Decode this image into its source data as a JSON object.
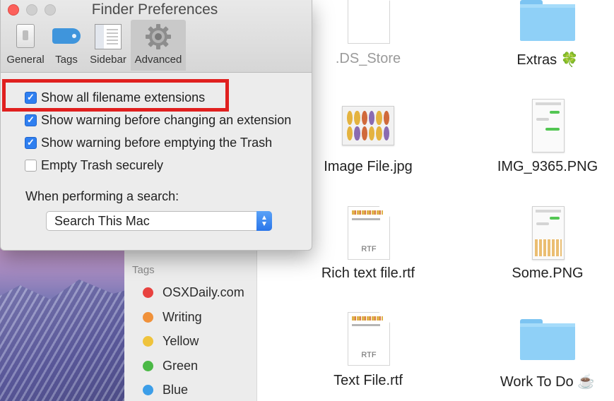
{
  "window": {
    "title": "Finder Preferences",
    "toolbar": [
      {
        "label": "General",
        "icon": "general-icon"
      },
      {
        "label": "Tags",
        "icon": "tag-icon"
      },
      {
        "label": "Sidebar",
        "icon": "sidebar-icon"
      },
      {
        "label": "Advanced",
        "icon": "gear-icon",
        "active": true
      }
    ]
  },
  "advanced": {
    "options": [
      {
        "label": "Show all filename extensions",
        "checked": true
      },
      {
        "label": "Show warning before changing an extension",
        "checked": true
      },
      {
        "label": "Show warning before emptying the Trash",
        "checked": true
      },
      {
        "label": "Empty Trash securely",
        "checked": false
      }
    ],
    "search_label": "When performing a search:",
    "search_value": "Search This Mac"
  },
  "sidebar": {
    "heading": "Tags",
    "tags": [
      {
        "label": "OSXDaily.com",
        "color": "#e8423f"
      },
      {
        "label": "Writing",
        "color": "#f0913a"
      },
      {
        "label": "Yellow",
        "color": "#efc33c"
      },
      {
        "label": "Green",
        "color": "#4bb946"
      },
      {
        "label": "Blue",
        "color": "#3c9ee8"
      }
    ]
  },
  "files": [
    {
      "name": ".DS_Store",
      "kind": "document",
      "dimmed": true
    },
    {
      "name": "Extras 🍀",
      "kind": "folder"
    },
    {
      "name": "Image File.jpg",
      "kind": "image"
    },
    {
      "name": "IMG_9365.PNG",
      "kind": "screenshot"
    },
    {
      "name": "Rich text file.rtf",
      "kind": "rtf",
      "badge": "RTF"
    },
    {
      "name": "Some.PNG",
      "kind": "screenshot"
    },
    {
      "name": "Text File.rtf",
      "kind": "rtf",
      "badge": "RTF"
    },
    {
      "name": "Work To Do ☕",
      "kind": "folder"
    }
  ],
  "colors": {
    "checkbox_accent": "#2f7ff0",
    "highlight_box": "#e0201f",
    "folder": "#8fd0f7"
  }
}
